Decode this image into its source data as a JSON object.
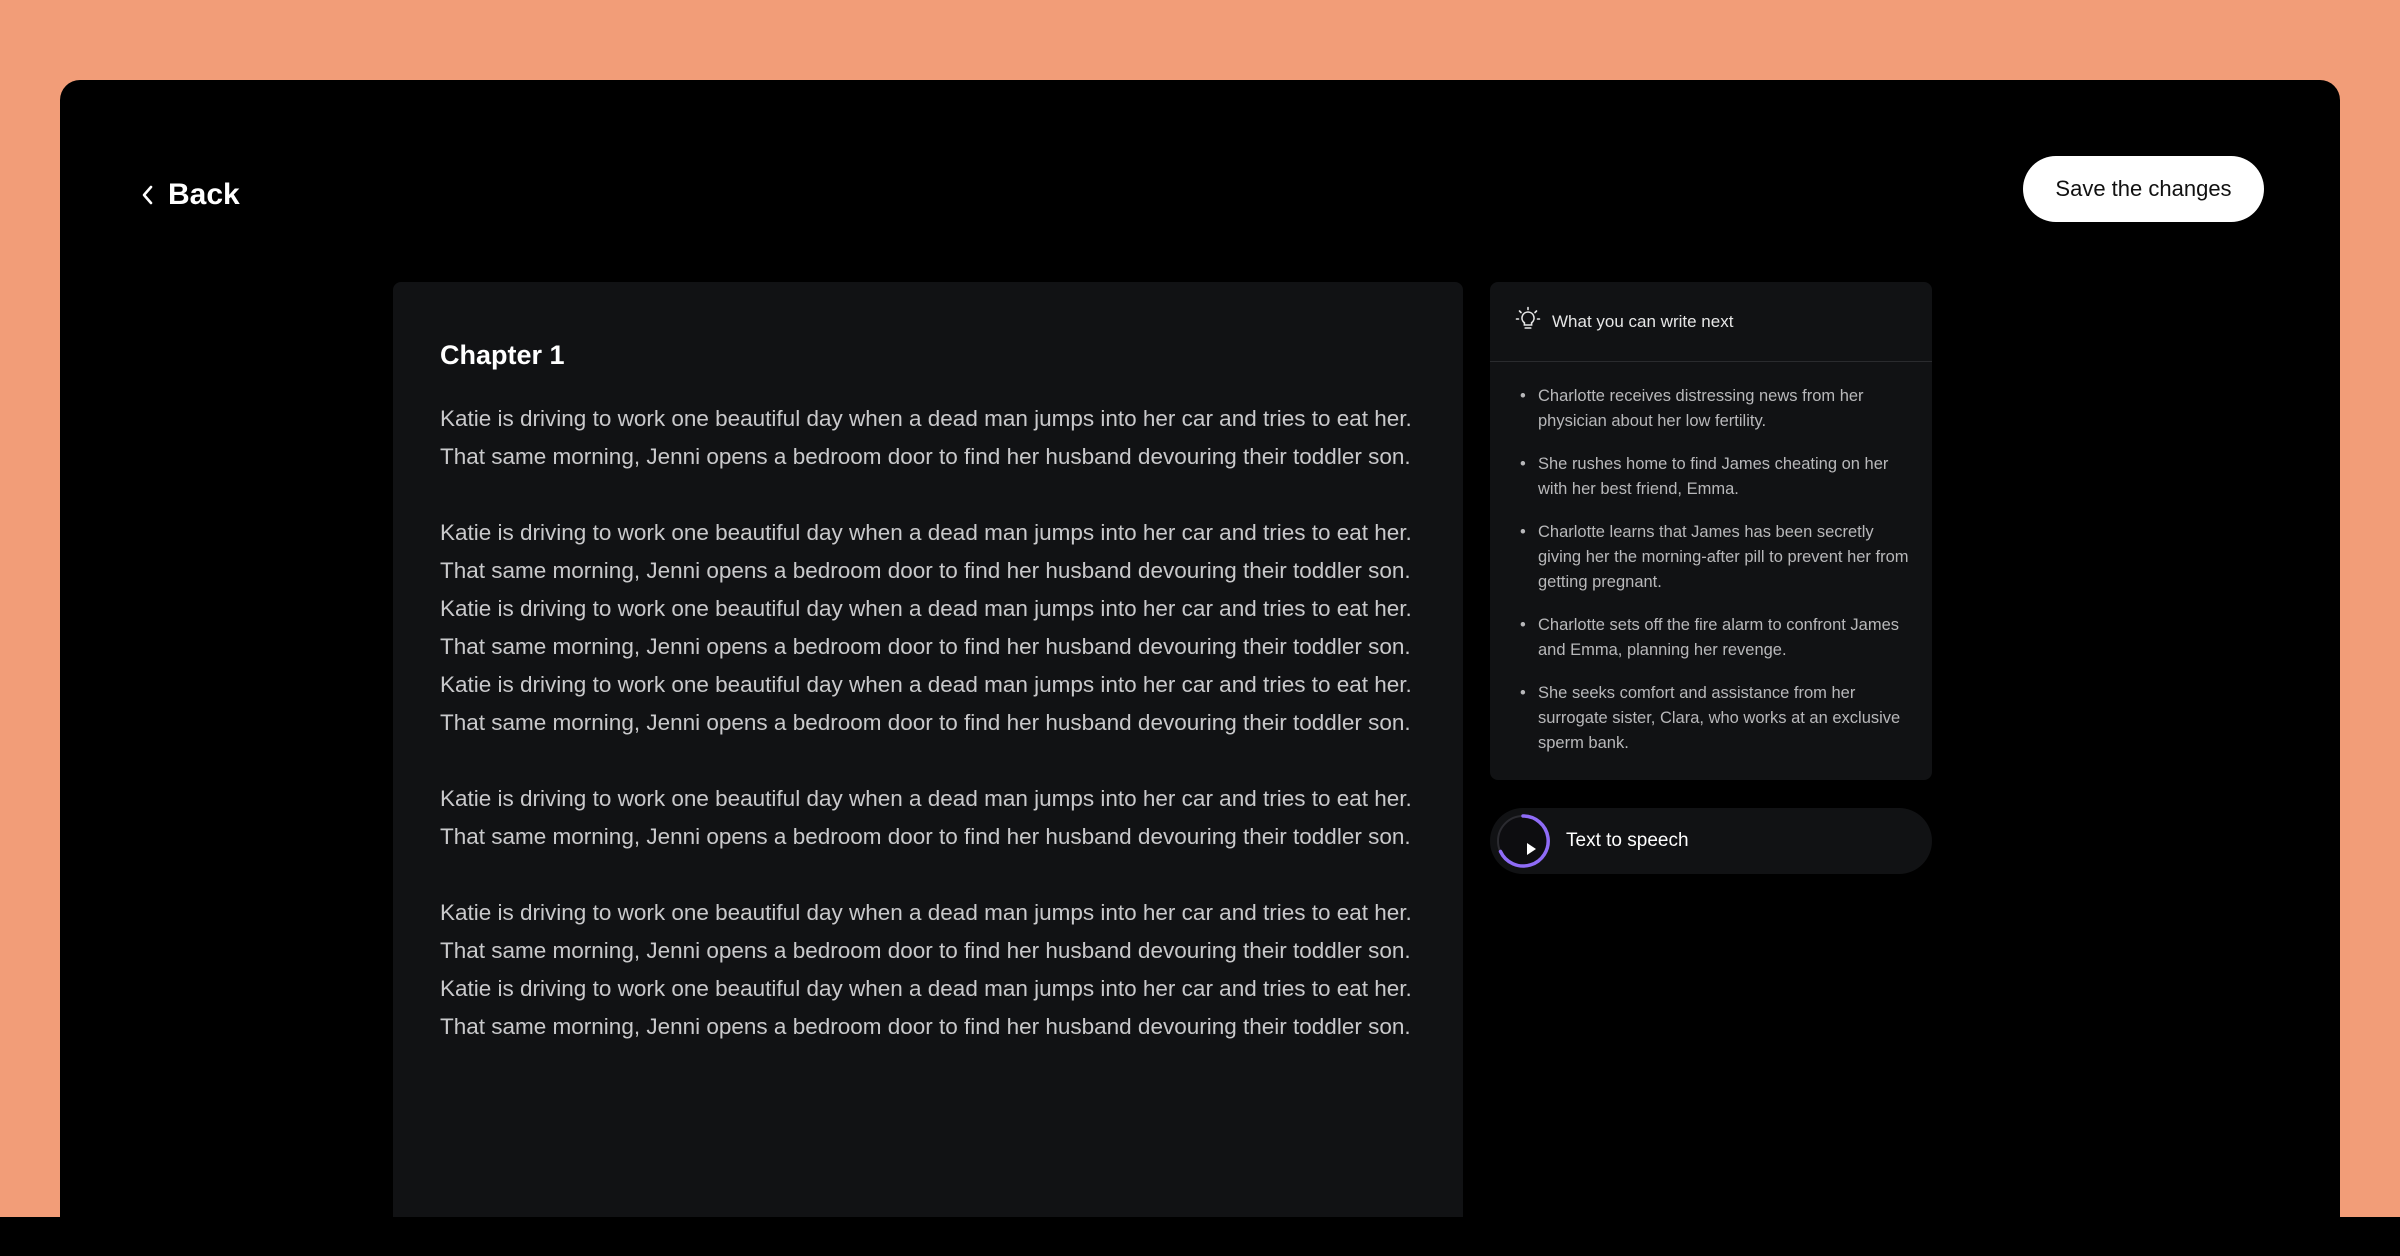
{
  "header": {
    "back_label": "Back",
    "save_label": "Save the changes"
  },
  "editor": {
    "chapter_title": "Chapter 1",
    "paragraphs": [
      "Katie is driving to work one beautiful day when a dead man jumps into her car and tries to eat her.  That same morning, Jenni opens a bedroom door to find her husband devouring their toddler son.",
      "Katie is driving to work one beautiful day when a dead man jumps into her car and tries to eat her.  That same morning, Jenni opens a bedroom door to find her husband devouring their toddler son. Katie is driving to work one beautiful day when a dead man jumps into her car and tries to eat her.  That same morning, Jenni opens a bedroom door to find her husband devouring their toddler son. Katie is driving to work one beautiful day when a dead man jumps into her car and tries to eat her.  That same morning, Jenni opens a bedroom door to find her husband devouring their toddler son.",
      "Katie is driving to work one beautiful day when a dead man jumps into her car and tries to eat her.  That same morning, Jenni opens a bedroom door to find her husband devouring their toddler son.",
      "Katie is driving to work one beautiful day when a dead man jumps into her car and tries to eat her.  That same morning, Jenni opens a bedroom door to find her husband devouring their toddler son. Katie is driving to work one beautiful day when a dead man jumps into her car and tries to eat her.  That same morning, Jenni opens a bedroom door to find her husband devouring their toddler son."
    ]
  },
  "suggestions": {
    "title": "What you can write next",
    "items": [
      "Charlotte receives distressing news from her physician about her low fertility.",
      "She rushes home to find James cheating on her with her best friend, Emma.",
      "Charlotte learns that James has been secretly giving her the morning-after pill to prevent her from getting pregnant.",
      "Charlotte sets off the fire alarm to confront James and Emma, planning her revenge.",
      "She seeks comfort and assistance from her surrogate sister, Clara, who works at an exclusive sperm bank."
    ]
  },
  "tts": {
    "label": "Text to speech"
  },
  "icons": {
    "back": "chevron-left-icon",
    "suggestions": "lightbulb-icon",
    "play": "play-icon"
  },
  "colors": {
    "background": "#f29d78",
    "window": "#000000",
    "panel": "#111214",
    "accent": "#8f6cf7"
  }
}
